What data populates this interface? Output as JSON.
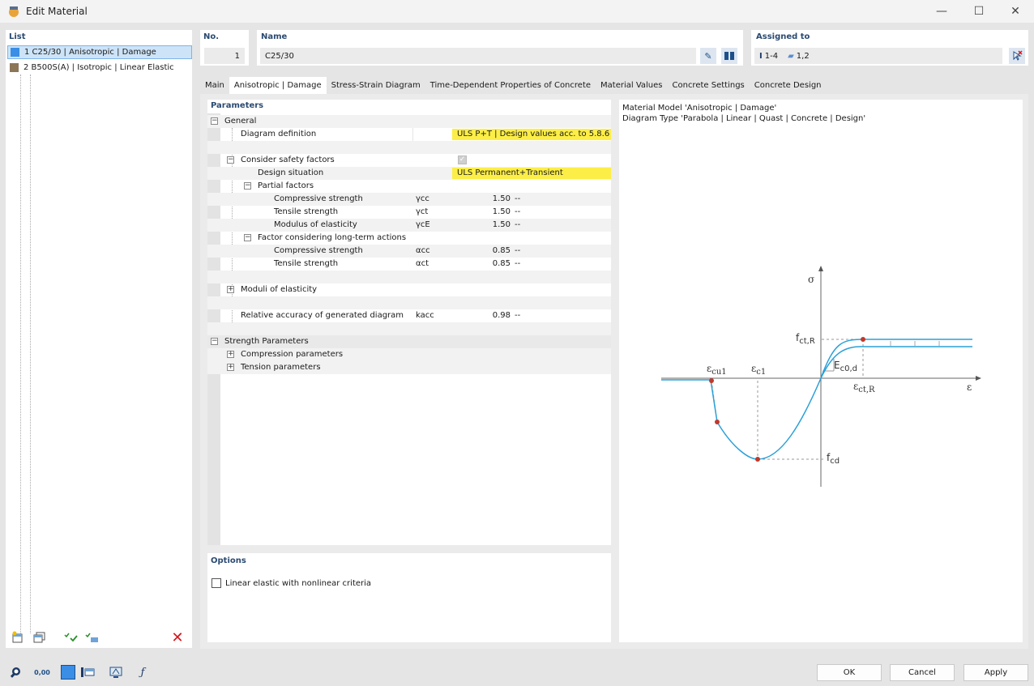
{
  "window": {
    "title": "Edit Material"
  },
  "list": {
    "header": "List",
    "items": [
      {
        "label": "1  C25/30 | Anisotropic | Damage",
        "color": "#3a8ee6",
        "selected": true
      },
      {
        "label": "2  B500S(A) | Isotropic | Linear Elastic",
        "color": "#8c7658",
        "selected": false
      }
    ]
  },
  "no": {
    "header": "No.",
    "value": "1"
  },
  "name": {
    "header": "Name",
    "value": "C25/30"
  },
  "assigned": {
    "header": "Assigned to",
    "members": "1-4",
    "surfaces": "1,2"
  },
  "tabs": [
    {
      "label": "Main",
      "active": false
    },
    {
      "label": "Anisotropic | Damage",
      "active": true
    },
    {
      "label": "Stress-Strain Diagram",
      "active": false
    },
    {
      "label": "Time-Dependent Properties of Concrete",
      "active": false
    },
    {
      "label": "Material Values",
      "active": false
    },
    {
      "label": "Concrete Settings",
      "active": false
    },
    {
      "label": "Concrete Design",
      "active": false
    }
  ],
  "parameters": {
    "header": "Parameters",
    "general": "General",
    "diagram_definition": {
      "label": "Diagram definition",
      "value": "ULS P+T | Design values acc. to 5.8.6"
    },
    "consider_safety": {
      "label": "Consider safety factors"
    },
    "design_situation": {
      "label": "Design situation",
      "value": "ULS Permanent+Transient"
    },
    "partial_factors": "Partial factors",
    "pf_compressive": {
      "label": "Compressive strength",
      "symbol": "γcc",
      "value": "1.50",
      "unit": "--"
    },
    "pf_tensile": {
      "label": "Tensile strength",
      "symbol": "γct",
      "value": "1.50",
      "unit": "--"
    },
    "pf_modulus": {
      "label": "Modulus of elasticity",
      "symbol": "γcE",
      "value": "1.50",
      "unit": "--"
    },
    "long_term": "Factor considering long-term actions",
    "lt_compressive": {
      "label": "Compressive strength",
      "symbol": "αcc",
      "value": "0.85",
      "unit": "--"
    },
    "lt_tensile": {
      "label": "Tensile strength",
      "symbol": "αct",
      "value": "0.85",
      "unit": "--"
    },
    "moduli": "Moduli of elasticity",
    "accuracy": {
      "label": "Relative accuracy of generated diagram",
      "symbol": "kacc",
      "value": "0.98",
      "unit": "--"
    },
    "strength": "Strength Parameters",
    "compression": "Compression parameters",
    "tension": "Tension parameters"
  },
  "options": {
    "header": "Options",
    "linear_elastic": "Linear elastic with nonlinear criteria"
  },
  "info": {
    "line1": "Material Model 'Anisotropic | Damage'",
    "line2": "Diagram Type 'Parabola | Linear | Quast | Concrete | Design'"
  },
  "diagram": {
    "sigma": "σ",
    "epsilon": "ε",
    "fctR_main": "f",
    "fctR_sub": "ct,R",
    "ecu1_main": "ε",
    "ecu1_sub": "cu1",
    "ec1_main": "ε",
    "ec1_sub": "c1",
    "Ec0d_main": "E",
    "Ec0d_sub": "c0,d",
    "ectR_main": "ε",
    "ectR_sub": "ct,R",
    "fcd_main": "f",
    "fcd_sub": "cd",
    "curve_color": "#2aa0d8",
    "point_color": "#c0392b"
  },
  "buttons": {
    "ok": "OK",
    "cancel": "Cancel",
    "apply": "Apply"
  },
  "bottom_icons": {
    "units_label": "0,00"
  }
}
